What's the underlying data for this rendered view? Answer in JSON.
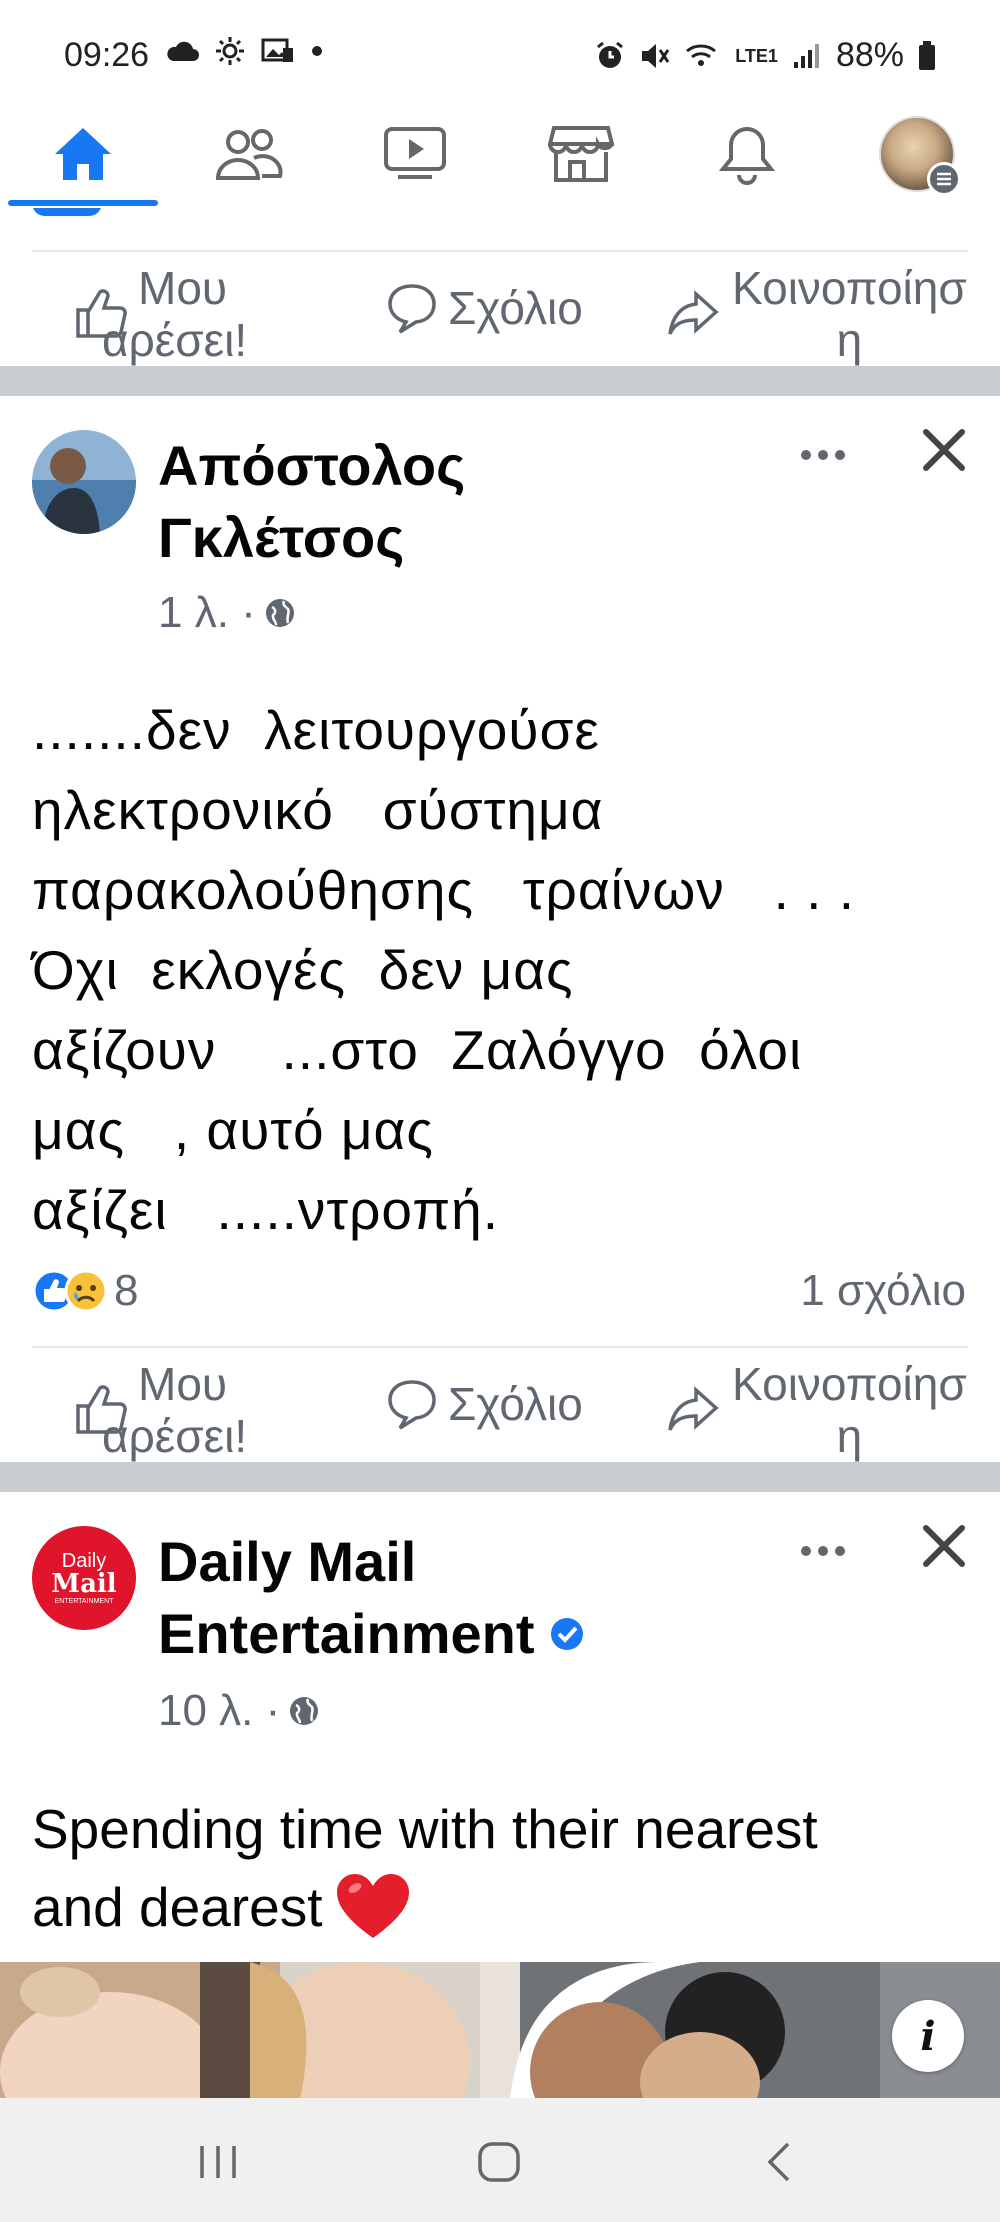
{
  "status_bar": {
    "time": "09:26",
    "network": "LTE1",
    "battery": "88%"
  },
  "nav": {
    "items": [
      "home-icon",
      "friends-icon",
      "watch-icon",
      "marketplace-icon",
      "notifications-icon",
      "profile-avatar"
    ],
    "active": "home"
  },
  "actions": {
    "like": [
      "Μου",
      "αρέσει!"
    ],
    "comment": "Σχόλιο",
    "share": [
      "Κοινοποίησ",
      "η"
    ]
  },
  "post1": {
    "author_line1": "Απόστολος",
    "author_line2": "Γκλέτσος",
    "time": "1 λ. ·",
    "text": ".......δεν  λειτουργούσε\nηλεκτρονικό   σύστημα\nπαρακολούθησης   τραίνων   . . .\nΌχι  εκλογές  δεν μας\nαξίζουν    ...στο  Ζαλόγγο  όλοι\nμας   , αυτό μας\nαξίζει   .....ντροπή.",
    "reaction_count": "8",
    "comments": "1 σχόλιο"
  },
  "post2": {
    "author_line1": "Daily Mail",
    "author_line2": "Entertainment",
    "time": "10 λ. ·",
    "text_line1": "Spending time with their nearest",
    "text_line2": "and dearest",
    "logo_line1": "Daily",
    "logo_line2": "Mail",
    "logo_line3": "ENTERTAINMENT",
    "info": "i"
  },
  "colors": {
    "accent": "#1877f2",
    "separator": "#c9ccd1",
    "secondary_text": "#606770"
  }
}
